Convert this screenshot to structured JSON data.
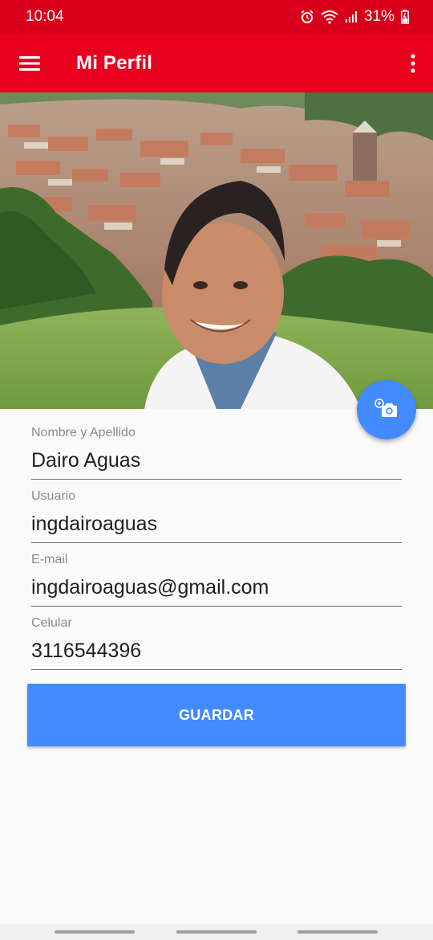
{
  "status_bar": {
    "time": "10:04",
    "battery_percent": "31%",
    "icons": [
      "alarm-icon",
      "wifi-icon",
      "signal-icon",
      "battery-icon"
    ]
  },
  "app_bar": {
    "title": "Mi Perfil",
    "menu_icon": "hamburger-menu-icon",
    "overflow_icon": "more-vert-icon",
    "color": "#e8001f"
  },
  "profile_photo": {
    "fab_icon": "add-photo-camera-icon",
    "fab_color": "#448aff"
  },
  "form": {
    "fields": [
      {
        "label": "Nombre y Apellido",
        "value": "Dairo Aguas"
      },
      {
        "label": "Usuario",
        "value": "ingdairoaguas"
      },
      {
        "label": "E-mail",
        "value": "ingdairoaguas@gmail.com"
      },
      {
        "label": "Celular",
        "value": "3116544396"
      }
    ],
    "save_label": "GUARDAR"
  }
}
